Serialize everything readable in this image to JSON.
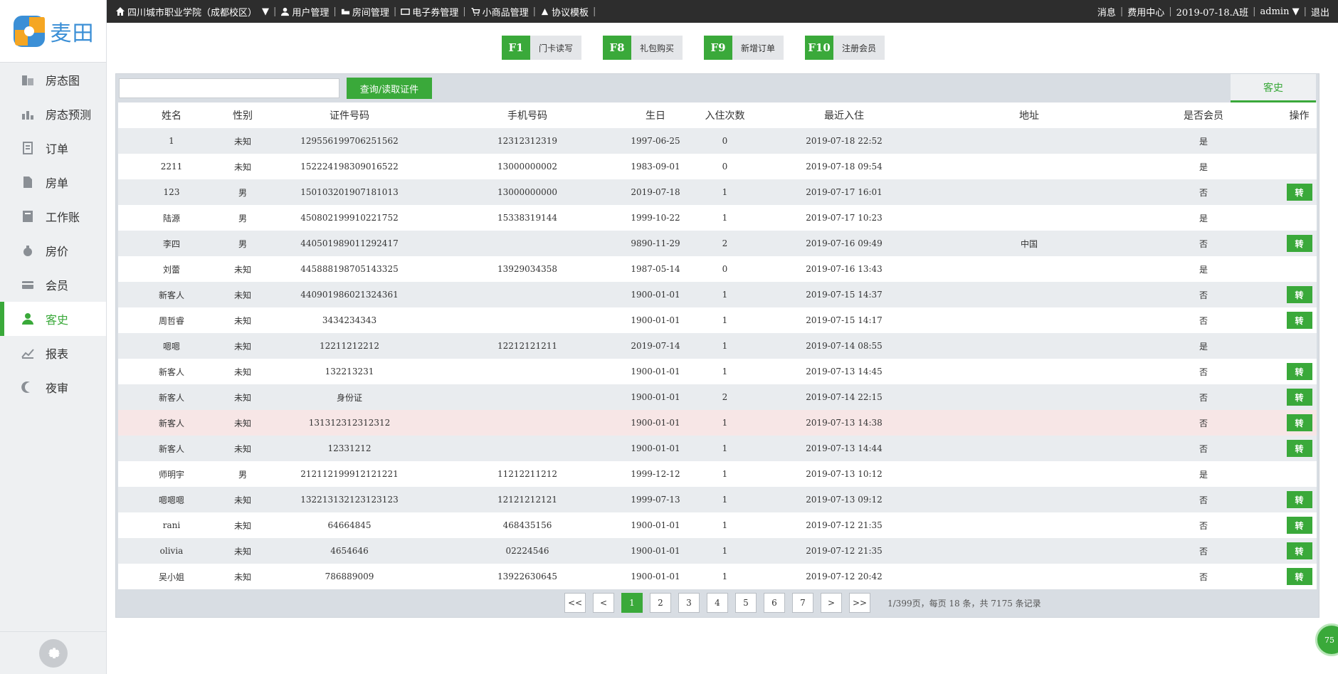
{
  "brand": {
    "name": "麦田",
    "colors": {
      "accent": "#3aa93a",
      "logo_blue": "#3b8fd6",
      "logo_orange": "#f5a623"
    }
  },
  "sidebar": {
    "items": [
      {
        "label": "房态图",
        "icon": "building-icon"
      },
      {
        "label": "房态预测",
        "icon": "bar-chart-icon"
      },
      {
        "label": "订单",
        "icon": "order-icon"
      },
      {
        "label": "房单",
        "icon": "document-icon"
      },
      {
        "label": "工作账",
        "icon": "ledger-icon"
      },
      {
        "label": "房价",
        "icon": "money-bag-icon"
      },
      {
        "label": "会员",
        "icon": "card-icon"
      },
      {
        "label": "客史",
        "icon": "user-icon",
        "active": true
      },
      {
        "label": "报表",
        "icon": "trend-chart-icon"
      },
      {
        "label": "夜审",
        "icon": "moon-icon"
      }
    ],
    "settings_icon": "gear-icon"
  },
  "topbar": {
    "hotel": "四川城市职业学院（成都校区）",
    "dropdown": "▼",
    "links": [
      "用户管理",
      "房间管理",
      "电子券管理",
      "小商品管理",
      "协议模板"
    ],
    "right": [
      "消息",
      "费用中心",
      "2019-07-18.A班",
      "admin ▼",
      "退出"
    ]
  },
  "fkeys": [
    {
      "key": "F1",
      "label": "门卡读写"
    },
    {
      "key": "F8",
      "label": "礼包购买"
    },
    {
      "key": "F9",
      "label": "新增订单"
    },
    {
      "key": "F10",
      "label": "注册会员"
    }
  ],
  "search": {
    "value": "",
    "placeholder": "",
    "button": "查询/读取证件",
    "tab": "客史"
  },
  "table": {
    "columns": [
      "姓名",
      "性别",
      "证件号码",
      "手机号码",
      "生日",
      "入住次数",
      "最近入住",
      "地址",
      "是否会员",
      "操作"
    ],
    "action_label": "转",
    "rows": [
      [
        "1",
        "未知",
        "129556199706251562",
        "12312312319",
        "1997-06-25",
        "0",
        "2019-07-18 22:52",
        "",
        "是",
        ""
      ],
      [
        "2211",
        "未知",
        "152224198309016522",
        "13000000002",
        "1983-09-01",
        "0",
        "2019-07-18 09:54",
        "",
        "是",
        ""
      ],
      [
        "123",
        "男",
        "150103201907181013",
        "13000000000",
        "2019-07-18",
        "1",
        "2019-07-17 16:01",
        "",
        "否",
        "转"
      ],
      [
        "陆源",
        "男",
        "450802199910221752",
        "15338319144",
        "1999-10-22",
        "1",
        "2019-07-17 10:23",
        "",
        "是",
        ""
      ],
      [
        "李四",
        "男",
        "440501989011292417",
        "",
        "9890-11-29",
        "2",
        "2019-07-16 09:49",
        "中国",
        "否",
        "转"
      ],
      [
        "刘蕾",
        "未知",
        "445888198705143325",
        "13929034358",
        "1987-05-14",
        "0",
        "2019-07-16 13:43",
        "",
        "是",
        ""
      ],
      [
        "新客人",
        "未知",
        "440901986021324361",
        "",
        "1900-01-01",
        "1",
        "2019-07-15 14:37",
        "",
        "否",
        "转"
      ],
      [
        "周哲睿",
        "未知",
        "3434234343",
        "",
        "1900-01-01",
        "1",
        "2019-07-15 14:17",
        "",
        "否",
        "转"
      ],
      [
        "嗯嗯",
        "未知",
        "12211212212",
        "12212121211",
        "2019-07-14",
        "1",
        "2019-07-14 08:55",
        "",
        "是",
        ""
      ],
      [
        "新客人",
        "未知",
        "132213231",
        "",
        "1900-01-01",
        "1",
        "2019-07-13 14:45",
        "",
        "否",
        "转"
      ],
      [
        "新客人",
        "未知",
        "身份证",
        "",
        "1900-01-01",
        "2",
        "2019-07-14 22:15",
        "",
        "否",
        "转"
      ],
      [
        "新客人",
        "未知",
        "131312312312312",
        "",
        "1900-01-01",
        "1",
        "2019-07-13 14:38",
        "",
        "否",
        "转"
      ],
      [
        "新客人",
        "未知",
        "12331212",
        "",
        "1900-01-01",
        "1",
        "2019-07-13 14:44",
        "",
        "否",
        "转"
      ],
      [
        "师明宇",
        "男",
        "212112199912121221",
        "11212211212",
        "1999-12-12",
        "1",
        "2019-07-13 10:12",
        "",
        "是",
        ""
      ],
      [
        "嗯嗯嗯",
        "未知",
        "132213132123123123",
        "12121212121",
        "1999-07-13",
        "1",
        "2019-07-13 09:12",
        "",
        "否",
        "转"
      ],
      [
        "rani",
        "未知",
        "64664845",
        "468435156",
        "1900-01-01",
        "1",
        "2019-07-12 21:35",
        "",
        "否",
        "转"
      ],
      [
        "olivia",
        "未知",
        "4654646",
        "02224546",
        "1900-01-01",
        "1",
        "2019-07-12 21:35",
        "",
        "否",
        "转"
      ],
      [
        "吴小姐",
        "未知",
        "786889009",
        "13922630645",
        "1900-01-01",
        "1",
        "2019-07-12 20:42",
        "",
        "否",
        "转"
      ]
    ],
    "highlight_row_index": 11
  },
  "pagination": {
    "buttons": [
      "<<",
      "<",
      "1",
      "2",
      "3",
      "4",
      "5",
      "6",
      "7",
      ">",
      ">>"
    ],
    "active": "1",
    "info": "1/399页，每页 18 条，共 7175 条记录"
  },
  "float_badge": "75"
}
